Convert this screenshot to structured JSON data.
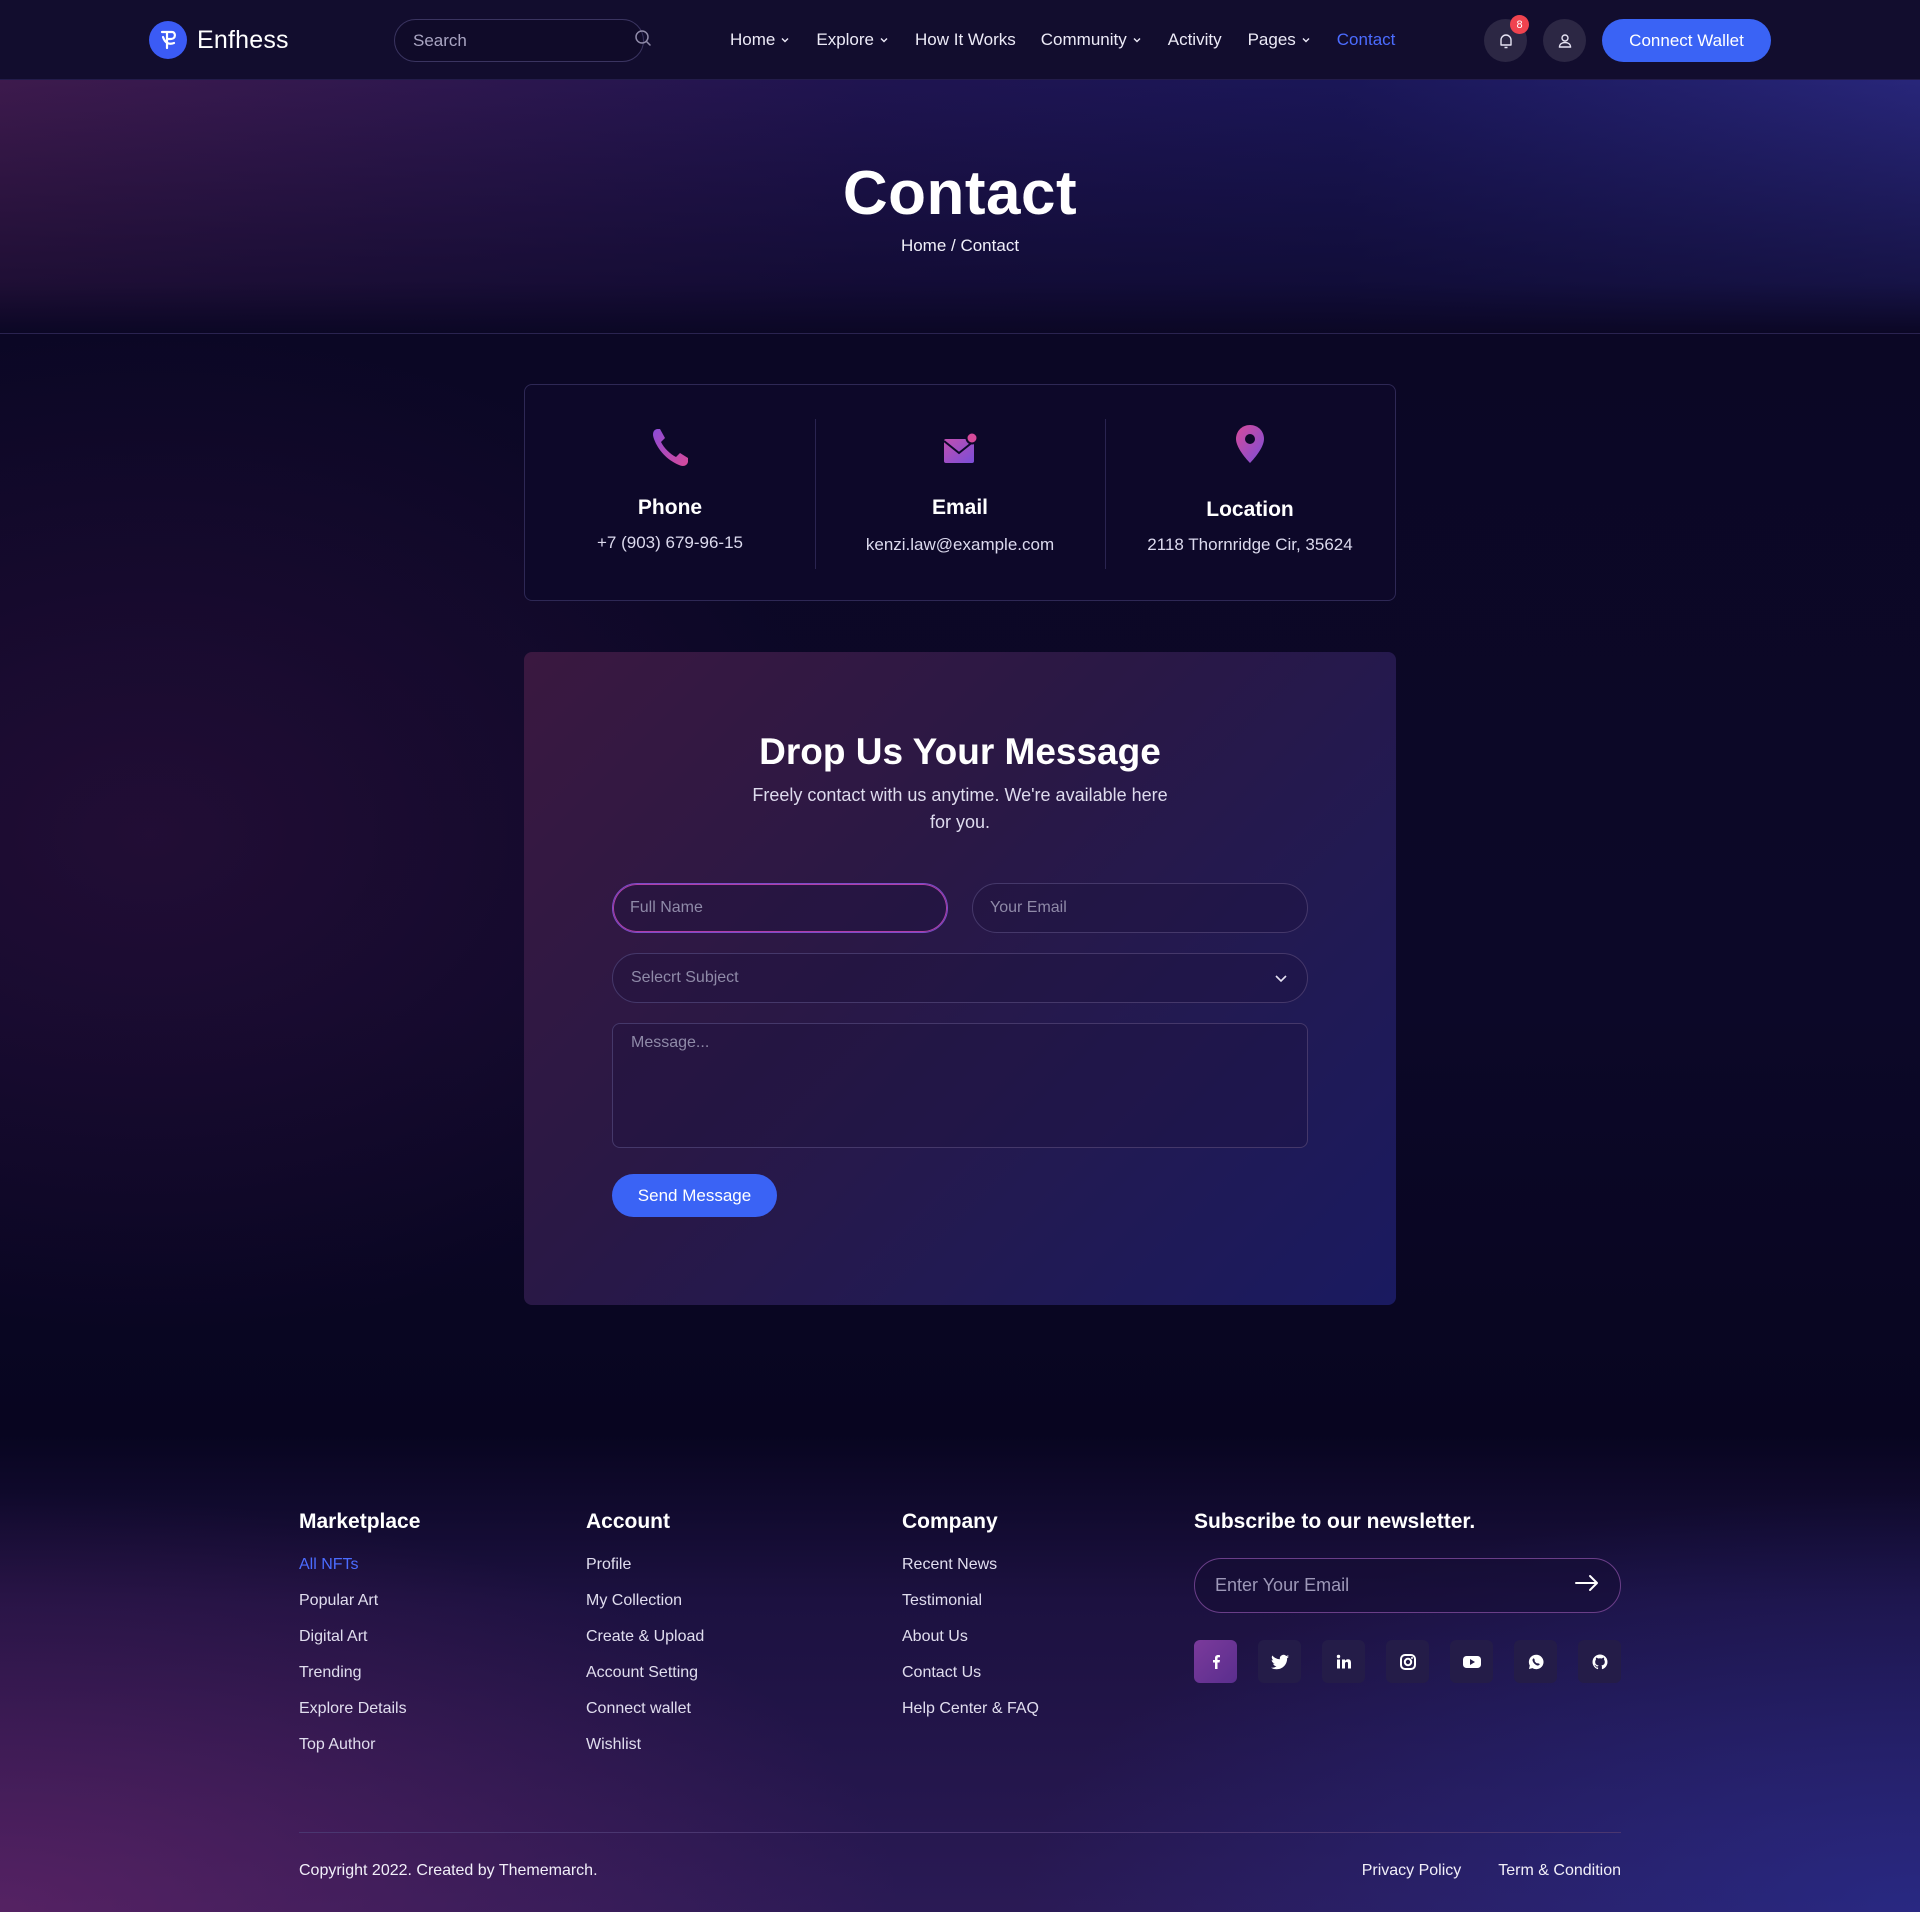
{
  "header": {
    "brand": "Enfhess",
    "search_placeholder": "Search",
    "nav": [
      {
        "label": "Home",
        "dropdown": true
      },
      {
        "label": "Explore",
        "dropdown": true
      },
      {
        "label": "How It Works",
        "dropdown": false
      },
      {
        "label": "Community",
        "dropdown": true
      },
      {
        "label": "Activity",
        "dropdown": false
      },
      {
        "label": "Pages",
        "dropdown": true
      },
      {
        "label": "Contact",
        "dropdown": false,
        "active": true
      }
    ],
    "notification_count": "8",
    "connect_label": "Connect Wallet"
  },
  "hero": {
    "title": "Contact",
    "breadcrumb": "Home / Contact"
  },
  "contact_info": [
    {
      "icon": "phone-icon",
      "title": "Phone",
      "value": "+7 (903) 679-96-15"
    },
    {
      "icon": "mail-icon",
      "title": "Email",
      "value": "kenzi.law@example.com"
    },
    {
      "icon": "location-pin-icon",
      "title": "Location",
      "value": "2118 Thornridge Cir, 35624"
    }
  ],
  "form": {
    "title": "Drop Us Your Message",
    "subtitle": "Freely contact with us anytime. We're available here for you.",
    "name_placeholder": "Full Name",
    "email_placeholder": "Your Email",
    "subject_placeholder": "Selecrt Subject",
    "message_placeholder": "Message...",
    "submit_label": "Send Message"
  },
  "footer": {
    "columns": [
      {
        "heading": "Marketplace",
        "links": [
          "All NFTs",
          "Popular Art",
          "Digital Art",
          "Trending",
          "Explore Details",
          "Top Author"
        ]
      },
      {
        "heading": "Account",
        "links": [
          "Profile",
          "My Collection",
          "Create & Upload",
          "Account Setting",
          "Connect wallet",
          "Wishlist"
        ]
      },
      {
        "heading": "Company",
        "links": [
          "Recent News",
          "Testimonial",
          "About Us",
          "Contact Us",
          "Help Center & FAQ"
        ]
      }
    ],
    "newsletter_heading": "Subscribe to our newsletter.",
    "newsletter_placeholder": "Enter Your Email",
    "socials": [
      "facebook-icon",
      "twitter-icon",
      "linkedin-icon",
      "instagram-icon",
      "youtube-icon",
      "whatsapp-icon",
      "github-icon"
    ],
    "copyright": "Copyright 2022. Created by Thememarch.",
    "legal_links": [
      "Privacy Policy",
      "Term & Condition"
    ]
  },
  "colors": {
    "accent": "#3a63f5",
    "background": "#0b0725",
    "active_link": "#4b6cff"
  }
}
